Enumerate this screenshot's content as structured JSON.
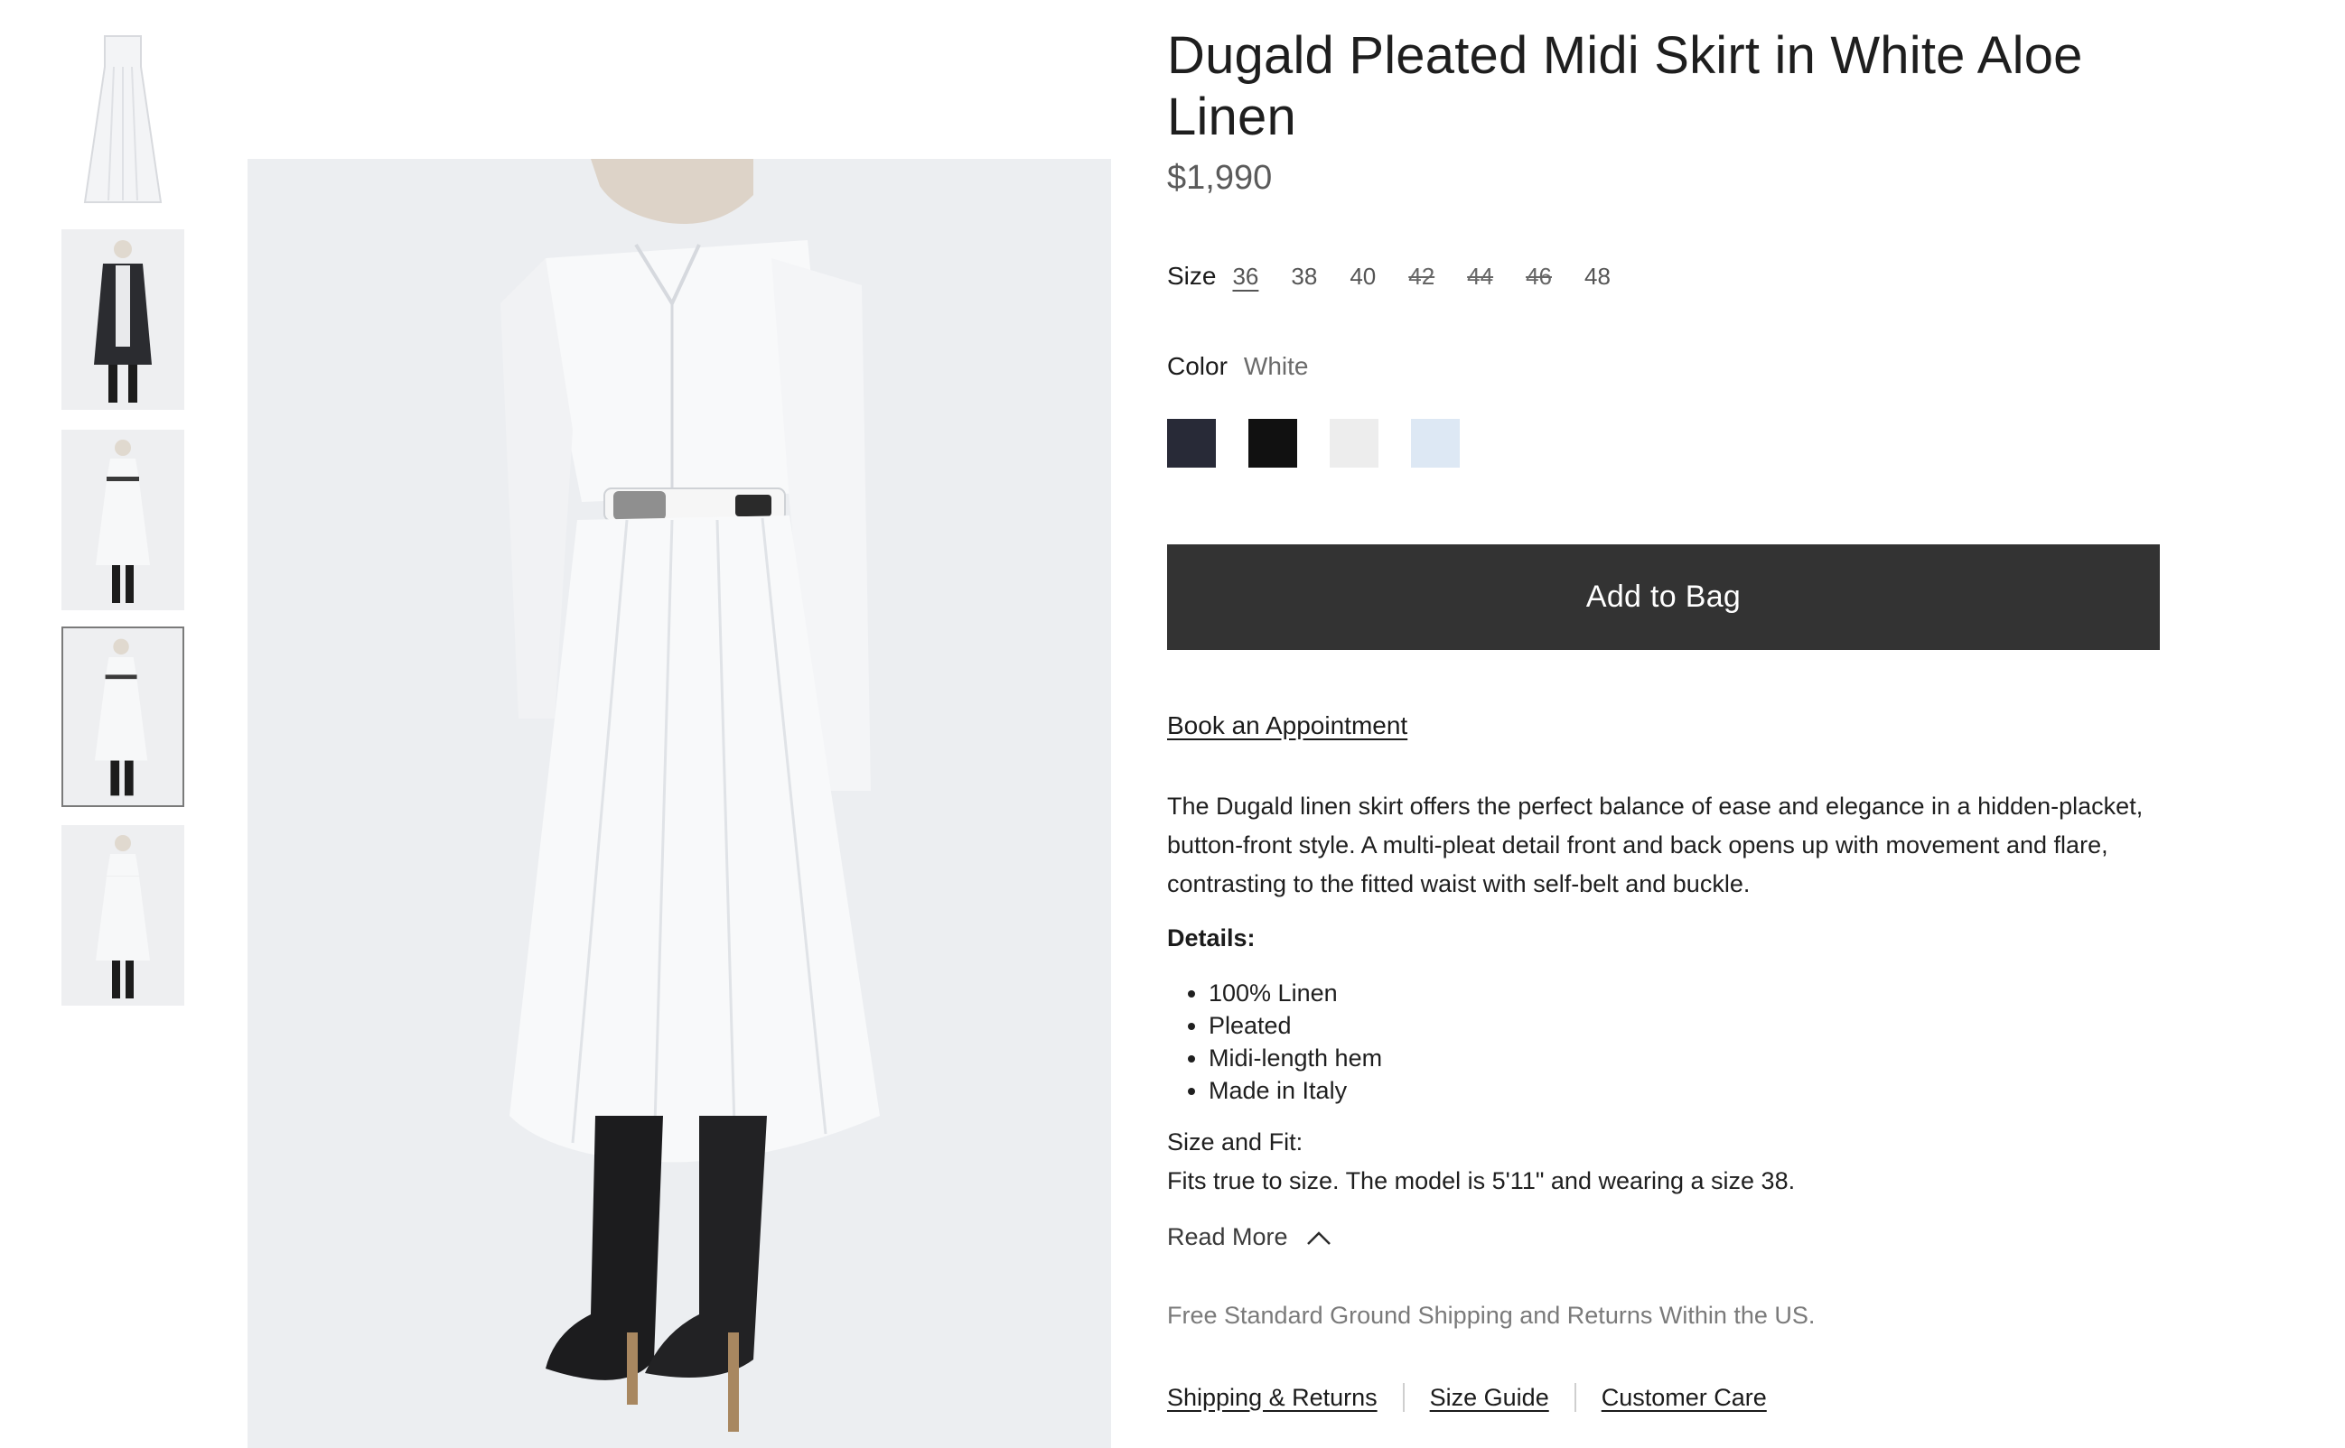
{
  "product": {
    "title": "Dugald Pleated Midi Skirt in White Aloe Linen",
    "price": "$1,990"
  },
  "size": {
    "label": "Size",
    "options": [
      {
        "label": "36",
        "state": "selected"
      },
      {
        "label": "38",
        "state": "available"
      },
      {
        "label": "40",
        "state": "available"
      },
      {
        "label": "42",
        "state": "unavailable"
      },
      {
        "label": "44",
        "state": "unavailable"
      },
      {
        "label": "46",
        "state": "unavailable"
      },
      {
        "label": "48",
        "state": "available"
      }
    ]
  },
  "color": {
    "label": "Color",
    "value": "White",
    "swatches": [
      {
        "name": "navy",
        "hex": "#282a37"
      },
      {
        "name": "black",
        "hex": "#111111"
      },
      {
        "name": "white",
        "hex": "#ededed"
      },
      {
        "name": "light-blue",
        "hex": "#dde8f4"
      }
    ]
  },
  "actions": {
    "add_to_bag": "Add to Bag",
    "book_appointment": "Book an Appointment"
  },
  "description": "The Dugald linen skirt offers the perfect balance of ease and elegance in a hidden-placket, button-front style. A multi-pleat detail front and back opens up with movement and flare, contrasting to the fitted waist with self-belt and buckle.",
  "details": {
    "heading": "Details:",
    "items": [
      "100% Linen",
      "Pleated",
      "Midi-length hem",
      "Made in Italy"
    ]
  },
  "fit": {
    "heading": "Size and Fit:",
    "text": "Fits true to size. The model is 5'11\" and wearing a size 38."
  },
  "read_more": "Read More",
  "shipping_note": "Free Standard Ground Shipping and Returns Within the US.",
  "footer_links": [
    "Shipping & Returns",
    "Size Guide",
    "Customer Care"
  ],
  "thumbnails": [
    {
      "subject": "skirt-flat"
    },
    {
      "subject": "model-dark-coat"
    },
    {
      "subject": "model-white-look-front"
    },
    {
      "subject": "model-white-look-side",
      "active": true
    },
    {
      "subject": "model-white-look-back"
    }
  ],
  "colors": {
    "button_bg": "#333333",
    "price_text": "#5b5b5b",
    "muted_text": "#7a7a7a"
  }
}
